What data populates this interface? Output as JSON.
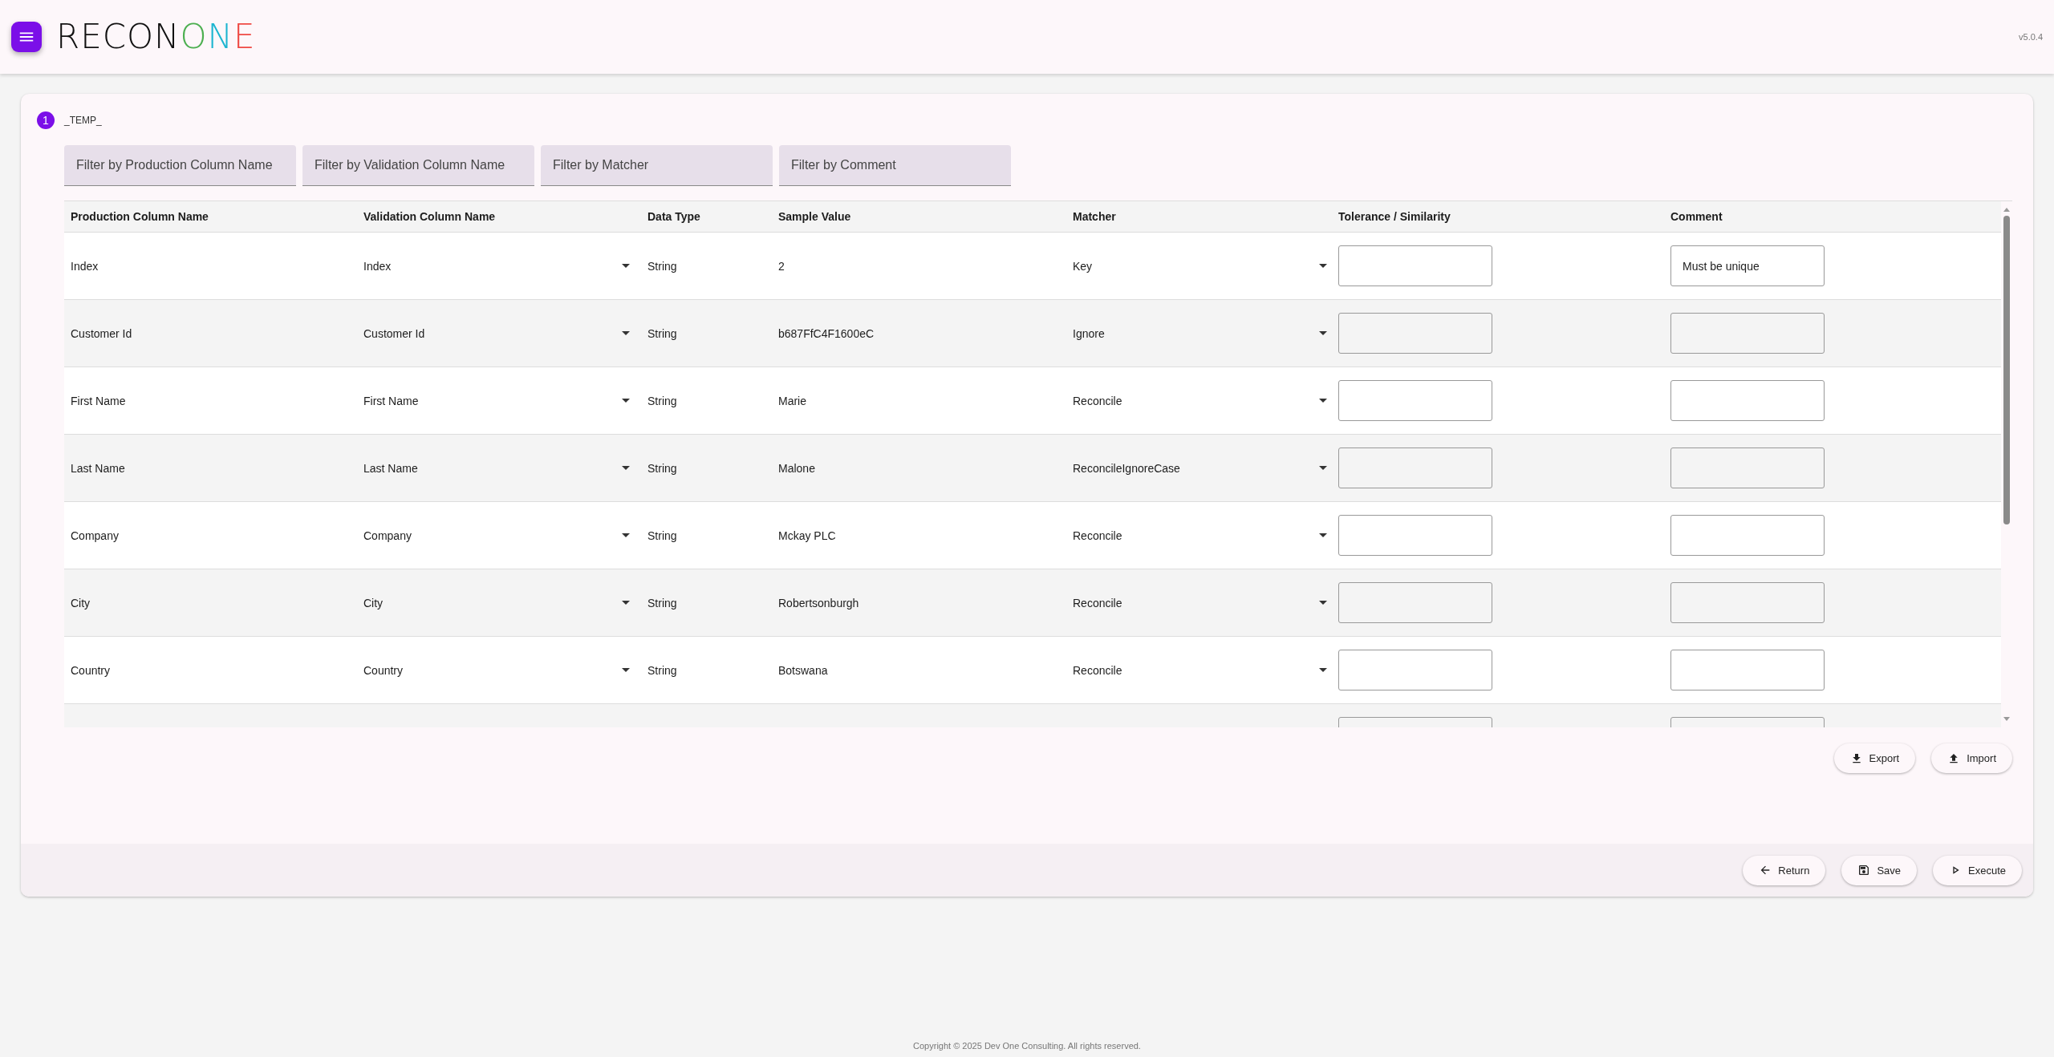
{
  "header": {
    "logo": [
      {
        "text": "RECON",
        "color": "#111111"
      },
      {
        "text": "O",
        "color": "#4caf50"
      },
      {
        "text": "N",
        "color": "#1cb5d0"
      },
      {
        "text": "E",
        "color": "#ef4b45"
      }
    ],
    "version": "v5.0.4"
  },
  "step": {
    "number": "1",
    "title": "_TEMP_"
  },
  "filters": [
    {
      "placeholder": "Filter by Production Column Name"
    },
    {
      "placeholder": "Filter by Validation Column Name"
    },
    {
      "placeholder": "Filter by Matcher"
    },
    {
      "placeholder": "Filter by Comment"
    }
  ],
  "table": {
    "columns": [
      "Production Column Name",
      "Validation Column Name",
      "Data Type",
      "Sample Value",
      "Matcher",
      "Tolerance / Similarity",
      "Comment"
    ],
    "rows": [
      {
        "production": "Index",
        "validation": "Index",
        "data_type": "String",
        "sample": "2",
        "matcher": "Key",
        "comment": "Must be unique"
      },
      {
        "production": "Customer Id",
        "validation": "Customer Id",
        "data_type": "String",
        "sample": "b687FfC4F1600eC",
        "matcher": "Ignore"
      },
      {
        "production": "First Name",
        "validation": "First Name",
        "data_type": "String",
        "sample": "Marie",
        "matcher": "Reconcile"
      },
      {
        "production": "Last Name",
        "validation": "Last Name",
        "data_type": "String",
        "sample": "Malone",
        "matcher": "ReconcileIgnoreCase"
      },
      {
        "production": "Company",
        "validation": "Company",
        "data_type": "String",
        "sample": "Mckay PLC",
        "matcher": "Reconcile"
      },
      {
        "production": "City",
        "validation": "City",
        "data_type": "String",
        "sample": "Robertsonburgh",
        "matcher": "Reconcile"
      },
      {
        "production": "Country",
        "validation": "Country",
        "data_type": "String",
        "sample": "Botswana",
        "matcher": "Reconcile"
      },
      {}
    ]
  },
  "table_actions": [
    {
      "kind": "export",
      "label": "Export"
    },
    {
      "kind": "import",
      "label": "Import"
    }
  ],
  "footer_actions": [
    {
      "kind": "return",
      "label": "Return"
    },
    {
      "kind": "save",
      "label": "Save"
    },
    {
      "kind": "execute",
      "label": "Execute"
    }
  ],
  "copyright": "Copyright © 2025 Dev One Consulting. All rights reserved."
}
